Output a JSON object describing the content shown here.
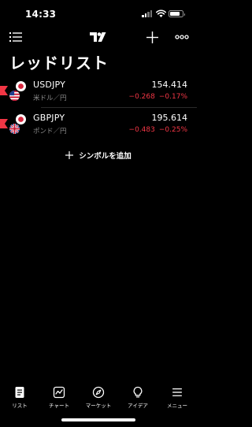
{
  "status_bar": {
    "time": "14:33"
  },
  "header": {
    "title": "レッドリスト"
  },
  "icons": {
    "menu": "menu-list-icon",
    "logo": "tradingview-logo-icon",
    "add": "add-icon",
    "more": "more-icon"
  },
  "colors": {
    "background": "#000000",
    "negative": "#f23645",
    "secondary_text": "#8c8c8c",
    "list_marker": "#f23645"
  },
  "watchlist": [
    {
      "symbol": "USDJPY",
      "description": "米ドル／円",
      "price": "154.414",
      "change": "−0.268",
      "change_percent": "−0.17%",
      "flags": [
        "jp-flag-icon",
        "us-flag-icon"
      ]
    },
    {
      "symbol": "GBPJPY",
      "description": "ポンド／円",
      "price": "195.614",
      "change": "−0.483",
      "change_percent": "−0.25%",
      "flags": [
        "jp-flag-icon",
        "gb-flag-icon"
      ]
    }
  ],
  "add_symbol": {
    "label": "シンボルを追加"
  },
  "bottom_nav": {
    "items": [
      {
        "label": "リスト",
        "icon": "list-icon"
      },
      {
        "label": "チャート",
        "icon": "chart-icon"
      },
      {
        "label": "マーケット",
        "icon": "compass-icon"
      },
      {
        "label": "アイデア",
        "icon": "lightbulb-icon"
      },
      {
        "label": "メニュー",
        "icon": "menu-icon"
      }
    ]
  }
}
